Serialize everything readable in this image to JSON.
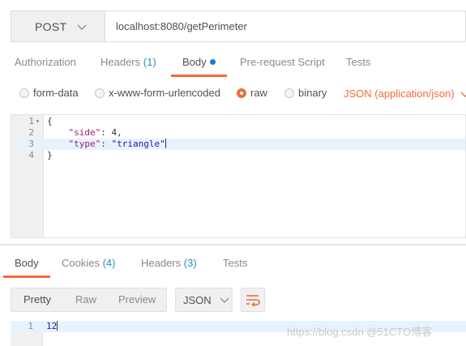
{
  "request": {
    "method": "POST",
    "url": "localhost:8080/getPerimeter"
  },
  "request_tabs": [
    {
      "label": "Authorization"
    },
    {
      "label": "Headers",
      "count": "(1)"
    },
    {
      "label": "Body"
    },
    {
      "label": "Pre-request Script"
    },
    {
      "label": "Tests"
    }
  ],
  "body_types": [
    "form-data",
    "x-www-form-urlencoded",
    "raw",
    "binary"
  ],
  "selected_body_type": "raw",
  "content_type": "JSON (application/json)",
  "editor": {
    "line_numbers": [
      "1",
      "2",
      "3",
      "4"
    ],
    "brace_open": "{",
    "key_side": "\"side\"",
    "val_side": "4",
    "key_type": "\"type\"",
    "val_type": "\"triangle\"",
    "brace_close": "}",
    "colon": ": ",
    "comma": ","
  },
  "response_tabs": [
    {
      "label": "Body"
    },
    {
      "label": "Cookies",
      "count": "(4)"
    },
    {
      "label": "Headers",
      "count": "(3)"
    },
    {
      "label": "Tests"
    }
  ],
  "view_modes": [
    "Pretty",
    "Raw",
    "Preview"
  ],
  "format": "JSON",
  "response": {
    "line_number": "1",
    "value": "12"
  },
  "watermark": "https://blog.csdn @51CTO博客",
  "colors": {
    "accent": "#f26b3a",
    "count_blue": "#2a8fbd",
    "body_dot": "#1f78d1"
  },
  "icons": [
    "chevron-down-icon",
    "wrap-lines-icon",
    "fold-arrow-icon"
  ]
}
